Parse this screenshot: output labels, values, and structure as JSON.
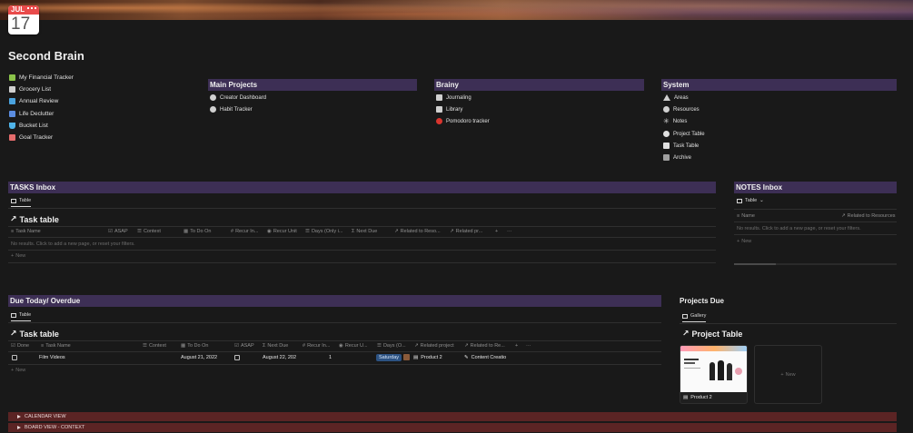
{
  "page": {
    "title": "Second Brain",
    "calendar_month": "JUL",
    "calendar_day": "17"
  },
  "sidebar_links": [
    {
      "label": "My Financial Tracker",
      "icon": "money-icon",
      "color": "#8bc34a"
    },
    {
      "label": "Grocery List",
      "icon": "cutlery-icon",
      "color": "#e0e0e0"
    },
    {
      "label": "Annual Review",
      "icon": "review-icon",
      "color": "#4aa3df"
    },
    {
      "label": "Life Declutter",
      "icon": "declutter-icon",
      "color": "#5b8de0"
    },
    {
      "label": "Bucket List",
      "icon": "bucket-icon",
      "color": "#4fb3e8"
    },
    {
      "label": "Goal Tracker",
      "icon": "target-icon",
      "color": "#e46c6c"
    }
  ],
  "columns": {
    "main_projects": {
      "title": "Main Projects",
      "links": [
        {
          "label": "Creator Dashboard",
          "icon": "creator-icon"
        },
        {
          "label": "Habit Tracker",
          "icon": "check-circle-icon"
        }
      ]
    },
    "brainy": {
      "title": "Brainy",
      "links": [
        {
          "label": "Journaling",
          "icon": "book-icon"
        },
        {
          "label": "Library",
          "icon": "library-icon"
        },
        {
          "label": "Pomodoro tracker",
          "icon": "tomato-icon"
        }
      ]
    },
    "system": {
      "title": "System",
      "links": [
        {
          "label": "Areas",
          "icon": "triangle-icon"
        },
        {
          "label": "Resources",
          "icon": "chat-bubble-icon"
        },
        {
          "label": "Notes",
          "icon": "asterisk-icon"
        },
        {
          "label": "Project Table",
          "icon": "circle-icon"
        },
        {
          "label": "Task Table",
          "icon": "square-icon"
        },
        {
          "label": "Archive",
          "icon": "archive-icon"
        }
      ]
    }
  },
  "tasks_inbox": {
    "title": "TASKS Inbox",
    "tab": "Table",
    "table_title": "Task table",
    "columns": [
      "Task Name",
      "ASAP",
      "Context",
      "To Do On",
      "Recur In...",
      "Recur Unit",
      "Days (Only i...",
      "Next Due",
      "Related to Reso...",
      "Related pr..."
    ],
    "empty_text": "No results. Click to add a new page, or reset your filters.",
    "new_label": "New"
  },
  "notes_inbox": {
    "title": "NOTES Inbox",
    "tab": "Table",
    "columns": [
      "Name",
      "Related to Resources"
    ],
    "empty_text": "No results. Click to add a new page, or reset your filters.",
    "new_label": "New"
  },
  "due_today": {
    "title": "Due Today/ Overdue",
    "tab": "Table",
    "table_title": "Task table",
    "columns": [
      "Done",
      "Task Name",
      "Context",
      "To Do On",
      "ASAP",
      "Next Due",
      "Recur In...",
      "Recur U...",
      "Days (O...",
      "Related project",
      "Related to Re..."
    ],
    "rows": [
      {
        "task": "Film Videos",
        "to_do_on": "August 21, 2022",
        "next_due": "August 22, 202",
        "recur_in": "1",
        "days": "Saturday",
        "project": "Product 2",
        "resource": "Content Creatio"
      }
    ],
    "new_label": "New"
  },
  "projects_due": {
    "title": "Projects Due",
    "tab": "Gallery",
    "table_title": "Project Table",
    "card_label": "Product 2",
    "new_label": "New"
  },
  "toggles": [
    "CALENDAR VIEW",
    "BOARD VIEW - CONTEXT"
  ],
  "colors": {
    "header_bar": "#3d2f55",
    "toggle_bar": "#5b2424",
    "background": "#191919"
  }
}
